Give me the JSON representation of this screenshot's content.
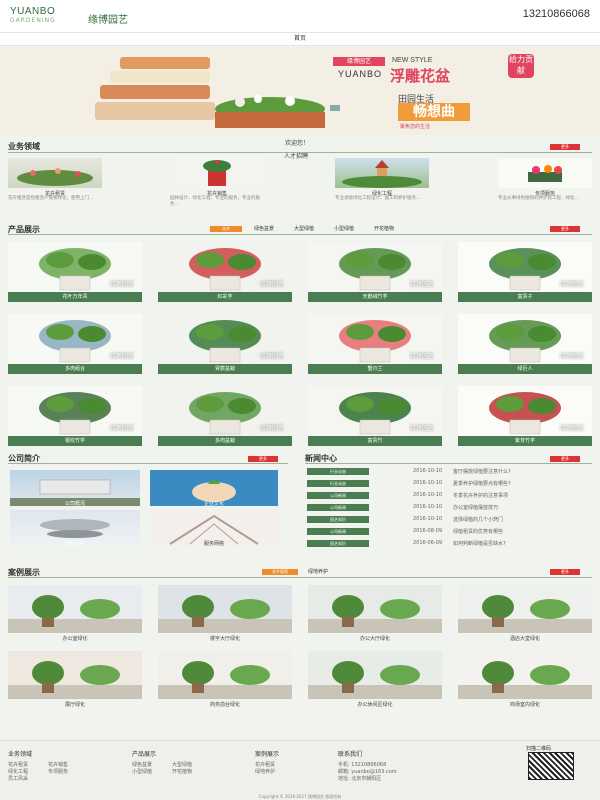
{
  "header": {
    "logo_en": "YUANBO",
    "logo_en2": "GARDENING",
    "logo_cn": "缘博园艺",
    "phone": "13210866068"
  },
  "nav": {
    "home": "首页"
  },
  "banner": {
    "brand_cn": "缘博园艺",
    "new_style": "NEW STYLE",
    "yuanbo": "YUANBO",
    "headline": "浮雕花盆",
    "badge": "给力贡献",
    "tagline": "田园生活",
    "big": "畅想曲",
    "cta": "聚焦您的生活"
  },
  "welcome": "欢迎您！",
  "business": {
    "title": "业务领域",
    "more": "更多",
    "talent": "人才招聘",
    "items": [
      {
        "name": "花卉租赁",
        "desc": "花卉租赁是指租赁产需要绿化，使用上门..."
      },
      {
        "name": "花卉销售",
        "desc": "园林设计、绿化工程、专业的服务，专业的服务..."
      },
      {
        "name": "绿化工程",
        "desc": "专业承接绿化工程设计、施工和养护服务..."
      },
      {
        "name": "专项服务",
        "desc": "专业从事绿色植物的养护及工程、绿化..."
      }
    ]
  },
  "products": {
    "title": "产品展示",
    "more": "更多",
    "tabs": [
      "花卉",
      "绿色盆景",
      "大型绿植",
      "小型绿植",
      "开花植物"
    ],
    "watermark": "缘博园艺",
    "items": [
      "花叶万年青",
      "红彩芋",
      "天鹅绒竹芋",
      "富贵子",
      "多肉组合",
      "肾蕨盆栽",
      "蟹爪兰",
      "绿巨人",
      "银纹竹芋",
      "多肉盆栽",
      "富贵竹",
      "紫背竹芋"
    ]
  },
  "about": {
    "title": "公司简介",
    "more": "更多",
    "items": [
      "公司概况",
      "企业文化",
      "团队风采",
      "服务网络"
    ]
  },
  "news": {
    "title": "新闻中心",
    "more": "更多",
    "rows": [
      {
        "tag": "行业动态",
        "date": "2016-10-10",
        "title": "客厅摆放绿植要注意什么?"
      },
      {
        "tag": "行业动态",
        "date": "2016-10-10",
        "title": "夏季养护绿植要点有哪些?"
      },
      {
        "tag": "公司新闻",
        "date": "2016-10-10",
        "title": "冬季花卉养护的注意事项"
      },
      {
        "tag": "公司新闻",
        "date": "2016-10-10",
        "title": "办公室绿植摆放技巧"
      },
      {
        "tag": "园艺知识",
        "date": "2016-10-10",
        "title": "选择绿植的几个小窍门"
      },
      {
        "tag": "公司新闻",
        "date": "2016-08-09",
        "title": "绿植租赁的优势有哪些"
      },
      {
        "tag": "园艺知识",
        "date": "2016-06-09",
        "title": "如何判断绿植是否缺水?"
      }
    ]
  },
  "cases": {
    "title": "案例展示",
    "tabs": [
      "花卉租赁",
      "绿地养护"
    ],
    "more": "更多",
    "items": [
      "办公室绿化",
      "楼宇大厅绿化",
      "办公大厅绿化",
      "酒店大堂绿化",
      "展厅绿化",
      "商务前台绿化",
      "办公休闲区绿化",
      "商场室内绿化"
    ]
  },
  "footer": {
    "col1": {
      "title": "业务领域",
      "links": [
        "花卉租赁",
        "花卉销售",
        "绿化工程",
        "专项服务",
        "员工风采"
      ]
    },
    "col2": {
      "title": "产品展示",
      "links": [
        "绿色盆景",
        "大型绿植",
        "小型绿植",
        "开花植物"
      ]
    },
    "col3": {
      "title": "案例展示",
      "links": [
        "花卉租赁",
        "绿地养护"
      ]
    },
    "col4": {
      "title": "联系我们",
      "lines": [
        "手机: 13210866068",
        "邮箱: yuanbo@163.com",
        "地址: 北京市朝阳区"
      ]
    },
    "qr_label": "扫描二维码",
    "copyright": "Copyright © 2016-2017 缘博园艺 版权所有"
  }
}
